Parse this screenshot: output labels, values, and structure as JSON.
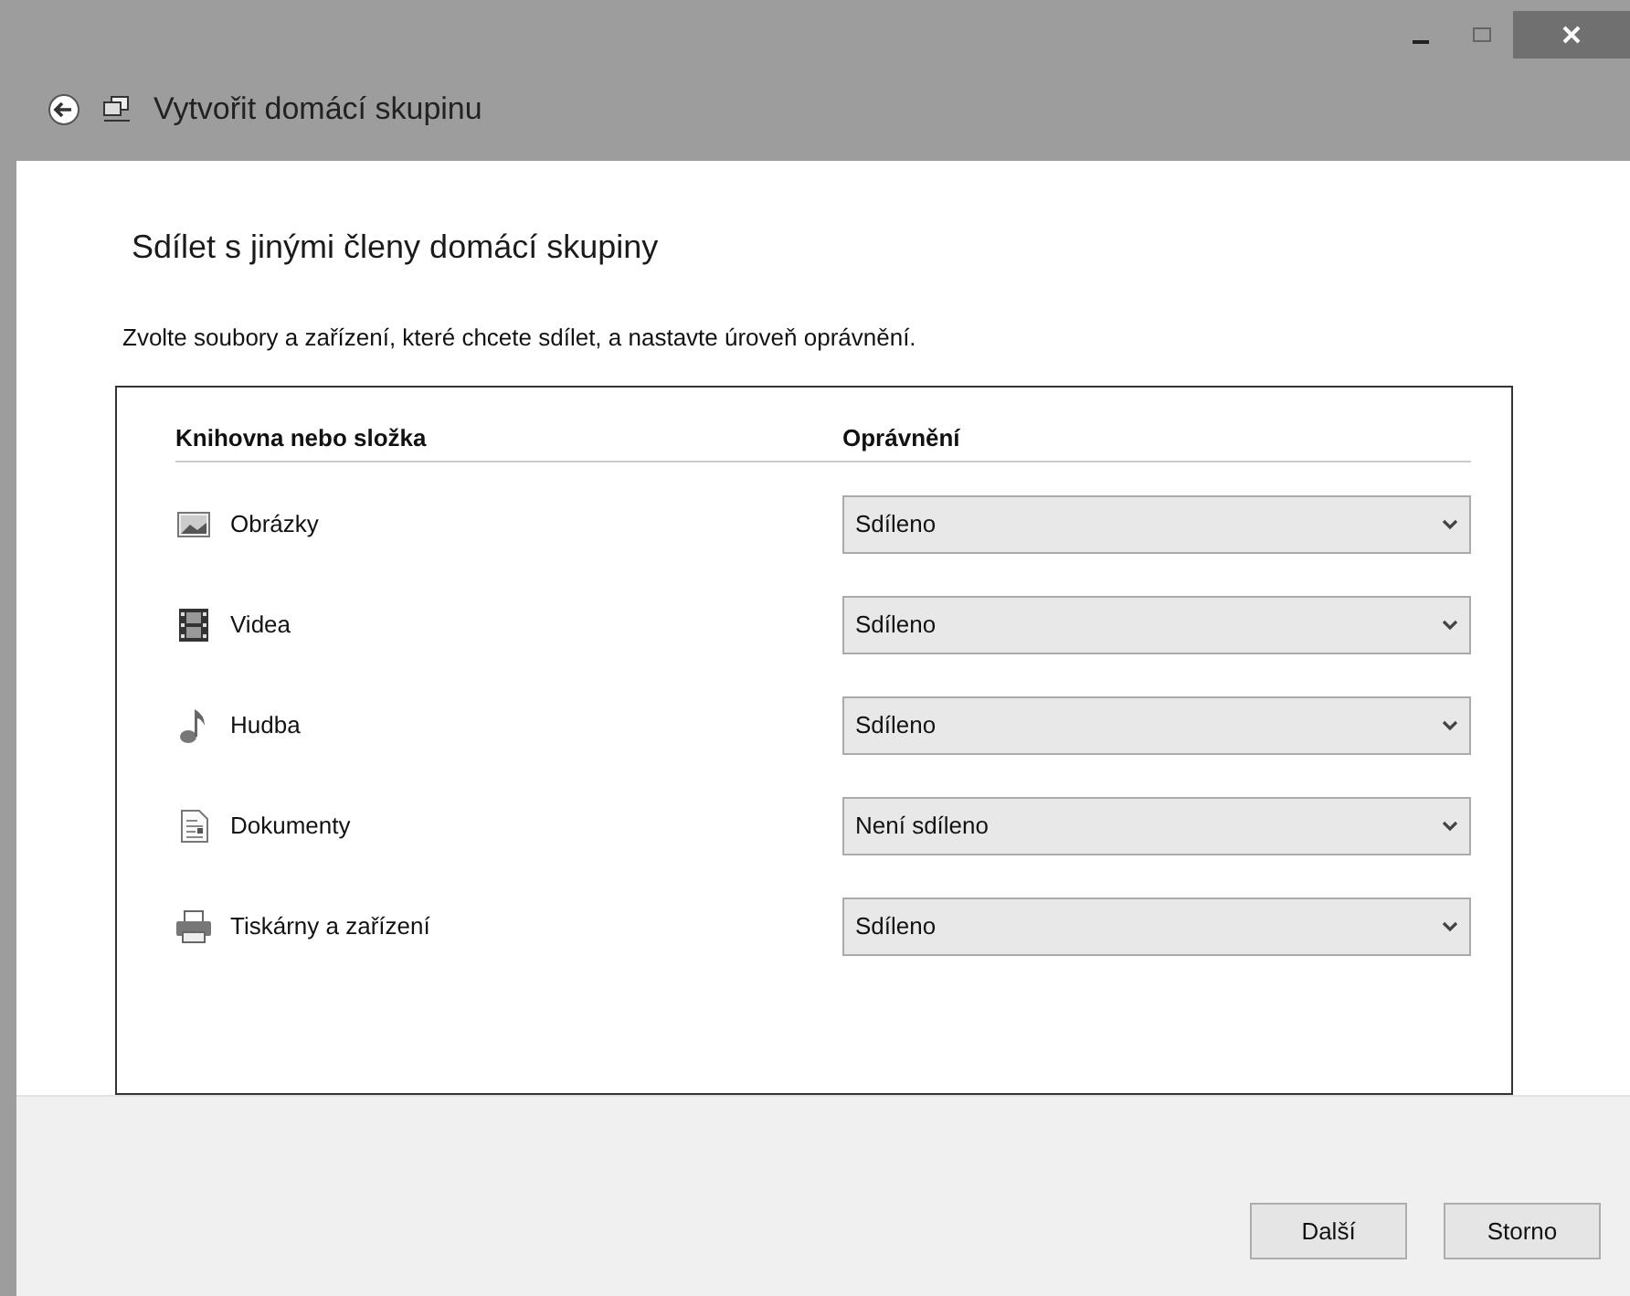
{
  "window": {
    "title": "Vytvořit domácí skupinu"
  },
  "heading": "Sdílet s jinými členy domácí skupiny",
  "instruction": "Zvolte soubory a zařízení, které chcete sdílet, a nastavte úroveň oprávnění.",
  "table": {
    "columns": [
      "Knihovna nebo složka",
      "Oprávnění"
    ],
    "rows": [
      {
        "kind": "pictures",
        "name": "Obrázky",
        "permission": "Sdíleno"
      },
      {
        "kind": "videos",
        "name": "Videa",
        "permission": "Sdíleno"
      },
      {
        "kind": "music",
        "name": "Hudba",
        "permission": "Sdíleno"
      },
      {
        "kind": "documents",
        "name": "Dokumenty",
        "permission": "Není sdíleno"
      },
      {
        "kind": "printers",
        "name": "Tiskárny a zařízení",
        "permission": "Sdíleno"
      }
    ]
  },
  "buttons": [
    "Další",
    "Storno"
  ]
}
